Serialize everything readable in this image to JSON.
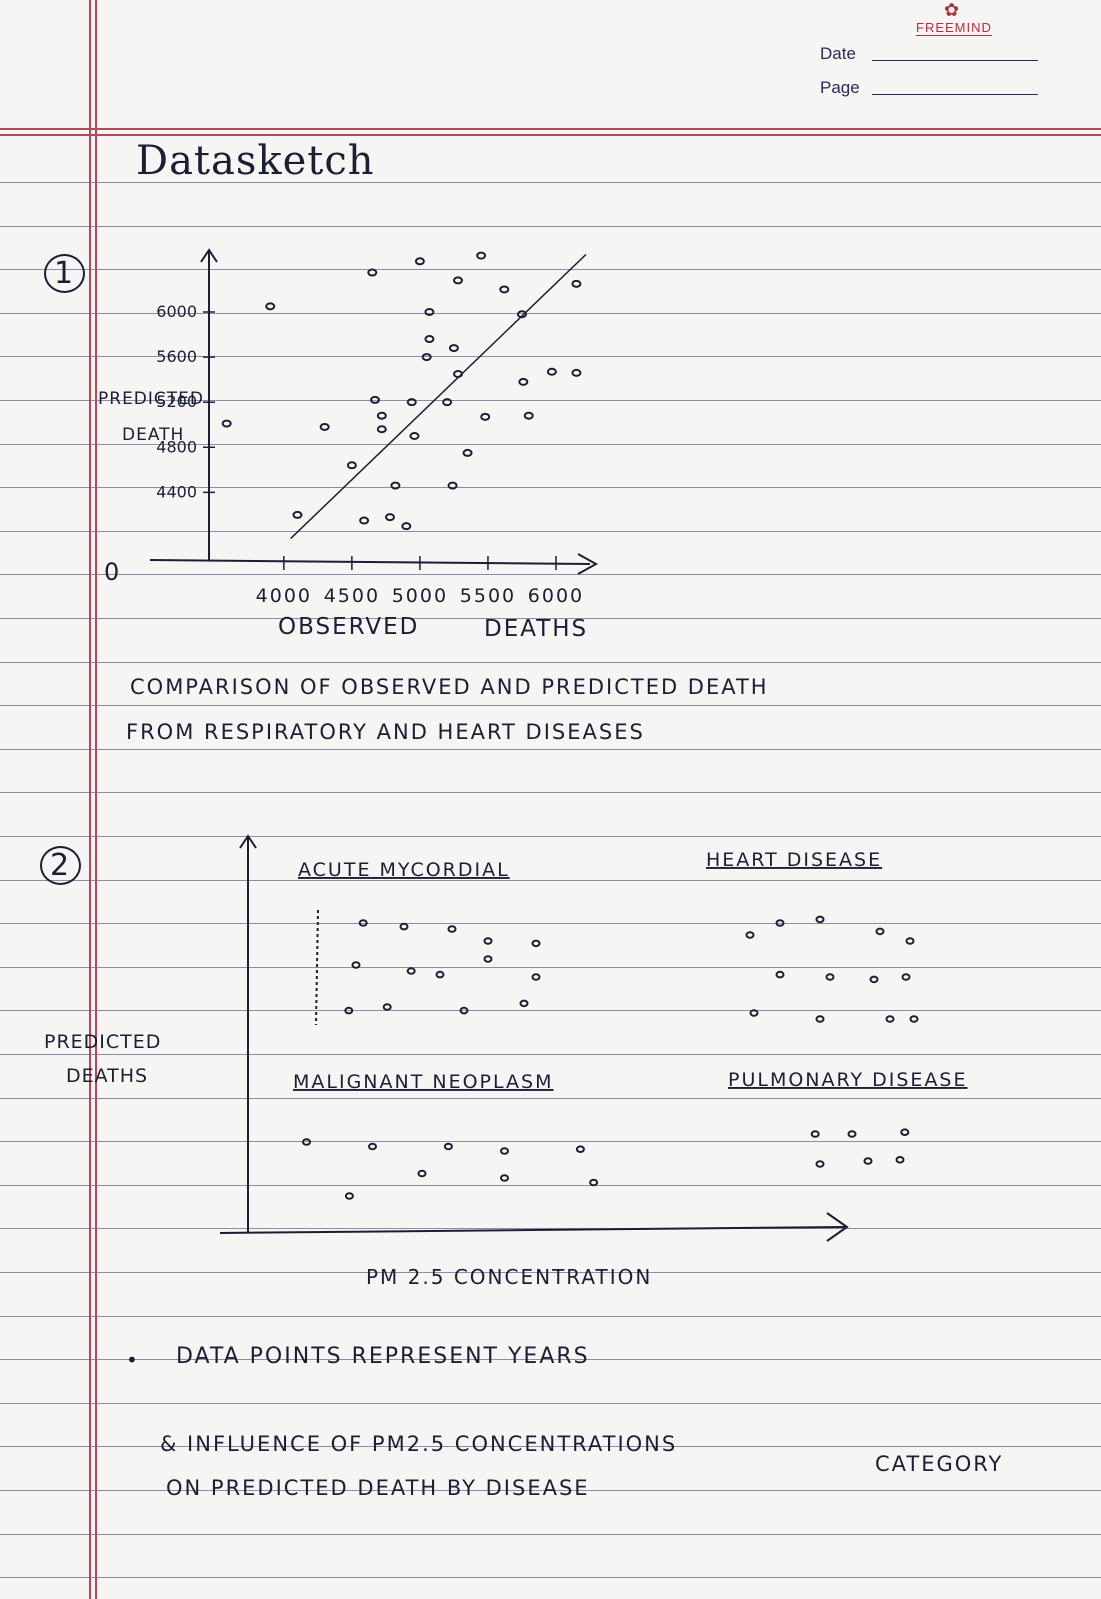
{
  "header": {
    "brand": "FREEMIND",
    "brand_icon": "flower-icon",
    "date_label": "Date",
    "page_label": "Page"
  },
  "title": "Datasketch",
  "sketch1": {
    "number": "1",
    "description_line1": "COMPARISON OF OBSERVED AND PREDICTED DEATH",
    "description_line2": "FROM RESPIRATORY AND HEART DISEASES"
  },
  "sketch2": {
    "number": "2",
    "bullet_line1": "DATA POINTS REPRESENT YEARS",
    "bullet_line2": "& INFLUENCE OF PM2.5 CONCENTRATIONS",
    "bullet_line3": "ON PREDICTED DEATH BY DISEASE",
    "bullet_line3b": "CATEGORY"
  },
  "chart_data": [
    {
      "type": "scatter",
      "title": "",
      "xlabel": "OBSERVED DEATHS",
      "ylabel": "PREDICTED DEATH",
      "x_ticks": [
        "4000",
        "4500",
        "5000",
        "5500",
        "6000"
      ],
      "y_ticks": [
        "4400",
        "4800",
        "5200",
        "5600",
        "6000"
      ],
      "origin_label": "0",
      "xlim": [
        3450,
        6250
      ],
      "ylim": [
        3800,
        6550
      ],
      "grid": false,
      "reference_line": "y = x",
      "points": [
        {
          "x": 3900,
          "y": 6050
        },
        {
          "x": 4650,
          "y": 6350
        },
        {
          "x": 5000,
          "y": 6450
        },
        {
          "x": 5450,
          "y": 6500
        },
        {
          "x": 5280,
          "y": 6280
        },
        {
          "x": 5070,
          "y": 6000
        },
        {
          "x": 5070,
          "y": 5760
        },
        {
          "x": 5620,
          "y": 6200
        },
        {
          "x": 5750,
          "y": 5980
        },
        {
          "x": 6150,
          "y": 6250
        },
        {
          "x": 5250,
          "y": 5680
        },
        {
          "x": 5050,
          "y": 5600
        },
        {
          "x": 5280,
          "y": 5450
        },
        {
          "x": 5760,
          "y": 5380
        },
        {
          "x": 5970,
          "y": 5470
        },
        {
          "x": 6150,
          "y": 5460
        },
        {
          "x": 4670,
          "y": 5220
        },
        {
          "x": 4720,
          "y": 5080
        },
        {
          "x": 4940,
          "y": 5200
        },
        {
          "x": 5200,
          "y": 5200
        },
        {
          "x": 5480,
          "y": 5070
        },
        {
          "x": 5800,
          "y": 5080
        },
        {
          "x": 4300,
          "y": 4980
        },
        {
          "x": 4500,
          "y": 4640
        },
        {
          "x": 4720,
          "y": 4960
        },
        {
          "x": 4960,
          "y": 4900
        },
        {
          "x": 5350,
          "y": 4750
        },
        {
          "x": 4820,
          "y": 4460
        },
        {
          "x": 5240,
          "y": 4460
        },
        {
          "x": 3580,
          "y": 5010
        },
        {
          "x": 4100,
          "y": 4200
        },
        {
          "x": 4590,
          "y": 4150
        },
        {
          "x": 4780,
          "y": 4180
        },
        {
          "x": 4900,
          "y": 4100
        }
      ]
    },
    {
      "type": "scatter",
      "title": "",
      "xlabel": "PM 2.5 CONCENTRATION",
      "ylabel": "PREDICTED DEATHS",
      "grid": false,
      "note": "faceted by disease category; each point is a year",
      "panels": [
        {
          "name": "ACUTE MYCORDIAL",
          "points": [
            {
              "x": 0.18,
              "y": 0.85
            },
            {
              "x": 0.35,
              "y": 0.82
            },
            {
              "x": 0.55,
              "y": 0.8
            },
            {
              "x": 0.7,
              "y": 0.7
            },
            {
              "x": 0.9,
              "y": 0.68
            },
            {
              "x": 0.15,
              "y": 0.5
            },
            {
              "x": 0.38,
              "y": 0.45
            },
            {
              "x": 0.5,
              "y": 0.42
            },
            {
              "x": 0.7,
              "y": 0.55
            },
            {
              "x": 0.9,
              "y": 0.4
            },
            {
              "x": 0.12,
              "y": 0.12
            },
            {
              "x": 0.28,
              "y": 0.15
            },
            {
              "x": 0.6,
              "y": 0.12
            },
            {
              "x": 0.85,
              "y": 0.18
            }
          ]
        },
        {
          "name": "HEART DISEASE",
          "points": [
            {
              "x": 0.1,
              "y": 0.75
            },
            {
              "x": 0.25,
              "y": 0.85
            },
            {
              "x": 0.45,
              "y": 0.88
            },
            {
              "x": 0.75,
              "y": 0.78
            },
            {
              "x": 0.9,
              "y": 0.7
            },
            {
              "x": 0.25,
              "y": 0.42
            },
            {
              "x": 0.5,
              "y": 0.4
            },
            {
              "x": 0.72,
              "y": 0.38
            },
            {
              "x": 0.88,
              "y": 0.4
            },
            {
              "x": 0.12,
              "y": 0.1
            },
            {
              "x": 0.45,
              "y": 0.05
            },
            {
              "x": 0.8,
              "y": 0.05
            },
            {
              "x": 0.92,
              "y": 0.05
            }
          ]
        },
        {
          "name": "MALIGNANT NEOPLASM",
          "points": [
            {
              "x": 0.05,
              "y": 0.7
            },
            {
              "x": 0.25,
              "y": 0.65
            },
            {
              "x": 0.48,
              "y": 0.65
            },
            {
              "x": 0.65,
              "y": 0.6
            },
            {
              "x": 0.88,
              "y": 0.62
            },
            {
              "x": 0.18,
              "y": 0.1
            },
            {
              "x": 0.4,
              "y": 0.35
            },
            {
              "x": 0.65,
              "y": 0.3
            },
            {
              "x": 0.92,
              "y": 0.25
            }
          ]
        },
        {
          "name": "PULMONARY DISEASE",
          "points": [
            {
              "x": 0.22,
              "y": 0.85
            },
            {
              "x": 0.45,
              "y": 0.85
            },
            {
              "x": 0.78,
              "y": 0.88
            },
            {
              "x": 0.25,
              "y": 0.35
            },
            {
              "x": 0.55,
              "y": 0.4
            },
            {
              "x": 0.75,
              "y": 0.42
            }
          ]
        }
      ]
    }
  ]
}
